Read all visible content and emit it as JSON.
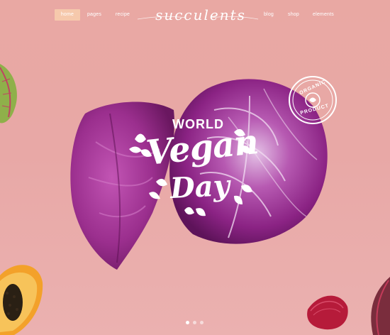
{
  "nav": {
    "items": [
      {
        "label": "home",
        "active": true
      },
      {
        "label": "pages",
        "active": false
      },
      {
        "label": "recipe",
        "active": false
      },
      {
        "label": "blog",
        "active": false
      },
      {
        "label": "shop",
        "active": false
      },
      {
        "label": "elements",
        "active": false
      }
    ],
    "logo": "succulents"
  },
  "hero": {
    "line1": "WORLD",
    "line2": "Vegan",
    "line3": "Day"
  },
  "badge": {
    "line1": "ORGANIC",
    "line2": "PRODUCT"
  },
  "slider": {
    "dots": 3,
    "active_index": 0
  },
  "colors": {
    "background": "#e9a8a3",
    "nav_active": "#f6c9ac",
    "cabbage": "#9b2f8e",
    "text": "#ffffff"
  },
  "icons": [
    "leaf-icon",
    "cabbage-image",
    "papaya-image",
    "beet-image",
    "organic-badge-icon"
  ]
}
